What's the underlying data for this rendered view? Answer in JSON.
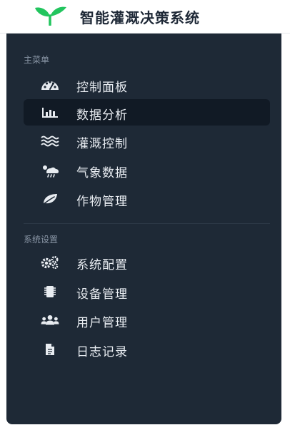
{
  "header": {
    "title": "智能灌溉决策系统",
    "brand_color": "#22c55e"
  },
  "sidebar": {
    "main_section": {
      "label": "主菜单",
      "items": [
        {
          "label": "控制面板",
          "icon": "dashboard-icon",
          "active": false
        },
        {
          "label": "数据分析",
          "icon": "bar-chart-icon",
          "active": true
        },
        {
          "label": "灌溉控制",
          "icon": "water-waves-icon",
          "active": false
        },
        {
          "label": "气象数据",
          "icon": "cloud-rain-icon",
          "active": false
        },
        {
          "label": "作物管理",
          "icon": "leaf-icon",
          "active": false
        }
      ]
    },
    "settings_section": {
      "label": "系统设置",
      "items": [
        {
          "label": "系统配置",
          "icon": "cogs-icon",
          "active": false
        },
        {
          "label": "设备管理",
          "icon": "microchip-icon",
          "active": false
        },
        {
          "label": "用户管理",
          "icon": "users-icon",
          "active": false
        },
        {
          "label": "日志记录",
          "icon": "file-icon",
          "active": false
        }
      ]
    }
  },
  "colors": {
    "sidebar_bg": "#1e2936",
    "active_bg": "#111a25",
    "text": "#e8ecf1",
    "section_text": "#8a96a6"
  }
}
